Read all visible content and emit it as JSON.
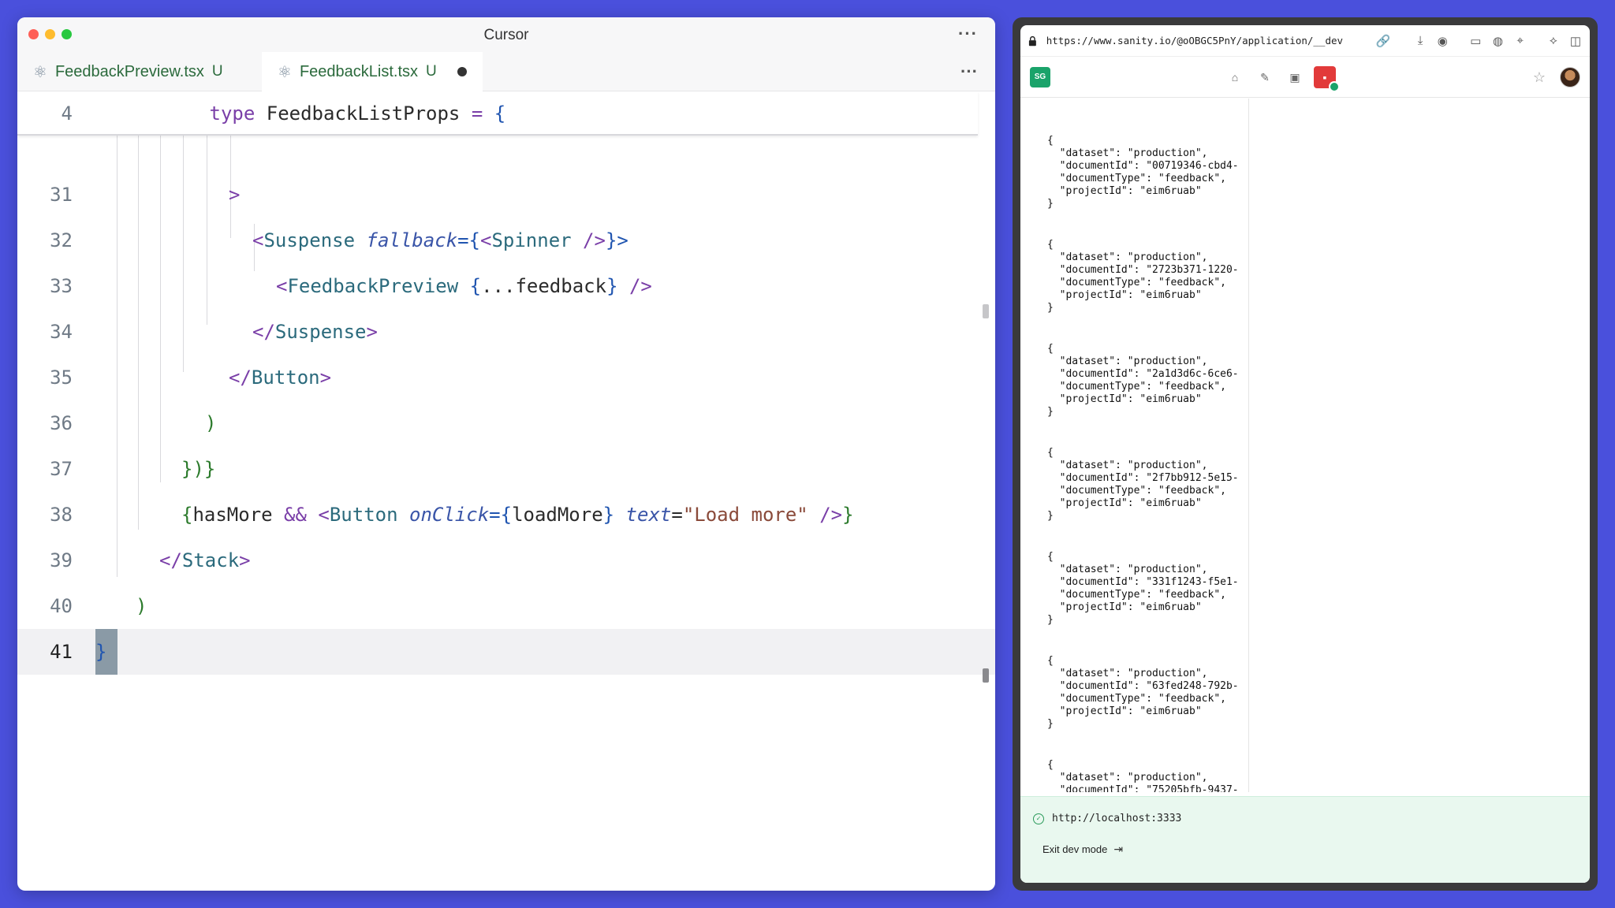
{
  "editor": {
    "title": "Cursor",
    "more": "···",
    "tabs": [
      {
        "name": "FeedbackPreview.tsx",
        "status": "U"
      },
      {
        "name": "FeedbackList.tsx",
        "status": "U"
      }
    ],
    "sticky": {
      "num": "4",
      "code": "type FeedbackListProps = {"
    },
    "lines": [
      {
        "num": "31"
      },
      {
        "num": "32"
      },
      {
        "num": "33"
      },
      {
        "num": "34"
      },
      {
        "num": "35"
      },
      {
        "num": "36"
      },
      {
        "num": "37"
      },
      {
        "num": "38"
      },
      {
        "num": "39"
      },
      {
        "num": "40"
      },
      {
        "num": "41"
      }
    ],
    "tokens": {
      "l31_gt": ">",
      "l32_open": "<",
      "l32_comp": "Suspense",
      "l32_attr": "fallback",
      "l32_eq": "={",
      "l32_lt2": "<",
      "l32_spinner": "Spinner",
      "l32_selfclose": " />",
      "l32_close": "}>",
      "l33_open": "<",
      "l33_comp": "FeedbackPreview",
      "l33_brace_open": " {",
      "l33_spread": "...feedback",
      "l33_brace_close": "}",
      "l33_selfclose": " />",
      "l34_close": "</",
      "l34_comp": "Suspense",
      "l34_gt": ">",
      "l35_close": "</",
      "l35_comp": "Button",
      "l35_gt": ">",
      "l36_paren": ")",
      "l37_text": "})}",
      "l38_brace": "{",
      "l38_has": "hasMore",
      "l38_and": " && ",
      "l38_lt": "<",
      "l38_comp": "Button",
      "l38_attr1": " onClick",
      "l38_eq1": "={",
      "l38_load": "loadMore",
      "l38_b1": "}",
      "l38_attr2": " text",
      "l38_eq2": "=",
      "l38_str": "\"Load more\"",
      "l38_sc": " />",
      "l38_end": "}",
      "l39_close": "</",
      "l39_comp": "Stack",
      "l39_gt": ">",
      "l40_paren": ")",
      "l41_brace": "}"
    },
    "sticky_tokens": {
      "kw": "type",
      "name": " FeedbackListProps ",
      "eq": "=",
      "brace": " {"
    }
  },
  "browser": {
    "url": "https://www.sanity.io/@oOBGC5PnY/application/__dev",
    "workspace_badge": "SG",
    "json_docs": [
      "{\n  \"dataset\": \"production\",\n  \"documentId\": \"00719346-cbd4-\n  \"documentType\": \"feedback\",\n  \"projectId\": \"eim6ruab\"\n}",
      "{\n  \"dataset\": \"production\",\n  \"documentId\": \"2723b371-1220-\n  \"documentType\": \"feedback\",\n  \"projectId\": \"eim6ruab\"\n}",
      "{\n  \"dataset\": \"production\",\n  \"documentId\": \"2a1d3d6c-6ce6-\n  \"documentType\": \"feedback\",\n  \"projectId\": \"eim6ruab\"\n}",
      "{\n  \"dataset\": \"production\",\n  \"documentId\": \"2f7bb912-5e15-\n  \"documentType\": \"feedback\",\n  \"projectId\": \"eim6ruab\"\n}",
      "{\n  \"dataset\": \"production\",\n  \"documentId\": \"331f1243-f5e1-\n  \"documentType\": \"feedback\",\n  \"projectId\": \"eim6ruab\"\n}",
      "{\n  \"dataset\": \"production\",\n  \"documentId\": \"63fed248-792b-\n  \"documentType\": \"feedback\",\n  \"projectId\": \"eim6ruab\"\n}",
      "{\n  \"dataset\": \"production\",\n  \"documentId\": \"75205bfb-9437-"
    ],
    "footer": {
      "localhost": "http://localhost:3333",
      "exit": "Exit dev mode"
    }
  }
}
